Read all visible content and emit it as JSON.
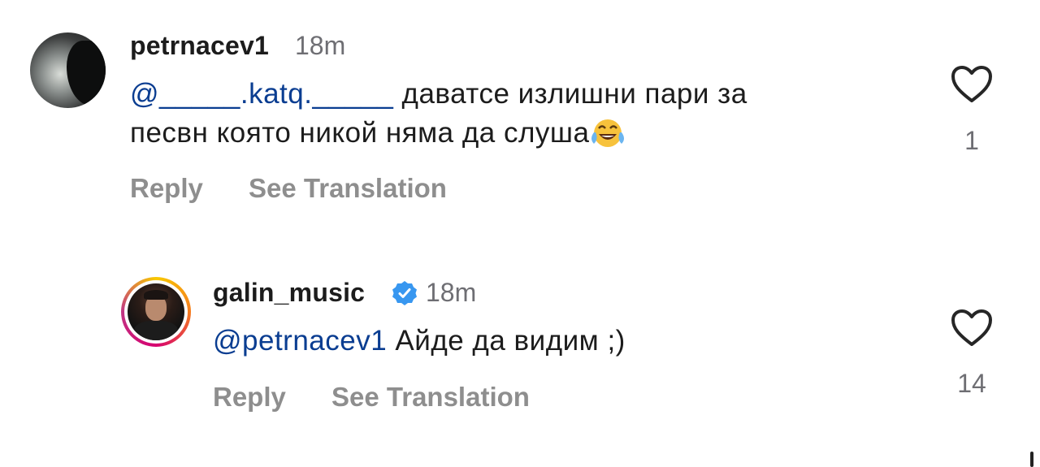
{
  "comments": [
    {
      "username": "petrnacev1",
      "time": "18m",
      "mention": "@_____.katq._____",
      "text_line1": " даватсе излишни пари за",
      "text_line2": "песвн която никой няма да слуша",
      "emoji": "laughing-tears-emoji",
      "reply_label": "Reply",
      "translate_label": "See Translation",
      "likes": "1"
    },
    {
      "username": "galin_music",
      "verified": true,
      "time": "18m",
      "mention": "@petrnacev1",
      "text": " Айде да видим ;)",
      "reply_label": "Reply",
      "translate_label": "See Translation",
      "likes": "14"
    }
  ],
  "colors": {
    "mention": "#0a3d91",
    "verified": "#3897f0",
    "secondary_text": "#8e8e8e",
    "primary_text": "#1c1c1c"
  }
}
